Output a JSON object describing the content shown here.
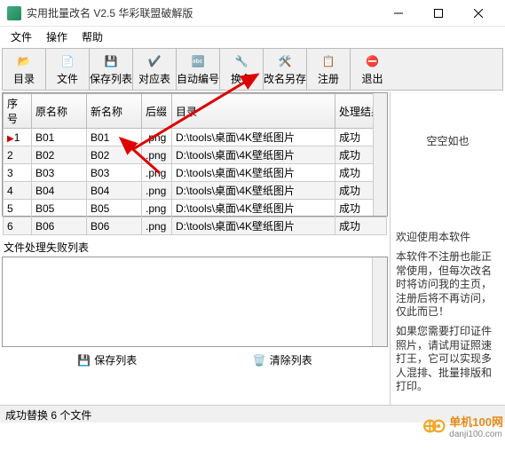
{
  "window": {
    "title": "实用批量改名 V2.5 华彩联盟破解版"
  },
  "menu": {
    "file": "文件",
    "operate": "操作",
    "help": "帮助"
  },
  "toolbar": {
    "dir": "目录",
    "files": "文件",
    "savelist": "保存列表",
    "map": "对应表",
    "autonum": "自动编号",
    "rename": "换名",
    "saveas": "改名另存",
    "register": "注册",
    "exit": "退出"
  },
  "table": {
    "headers": {
      "index": "序号",
      "oldname": "原名称",
      "newname": "新名称",
      "ext": "后缀",
      "dir": "目录",
      "result": "处理结果"
    },
    "rows": [
      {
        "idx": "1",
        "old": "B01",
        "new": "B01",
        "ext": ".png",
        "dir": "D:\\tools\\桌面\\4K壁纸图片",
        "res": "成功"
      },
      {
        "idx": "2",
        "old": "B02",
        "new": "B02",
        "ext": ".png",
        "dir": "D:\\tools\\桌面\\4K壁纸图片",
        "res": "成功"
      },
      {
        "idx": "3",
        "old": "B03",
        "new": "B03",
        "ext": ".png",
        "dir": "D:\\tools\\桌面\\4K壁纸图片",
        "res": "成功"
      },
      {
        "idx": "4",
        "old": "B04",
        "new": "B04",
        "ext": ".png",
        "dir": "D:\\tools\\桌面\\4K壁纸图片",
        "res": "成功"
      },
      {
        "idx": "5",
        "old": "B05",
        "new": "B05",
        "ext": ".png",
        "dir": "D:\\tools\\桌面\\4K壁纸图片",
        "res": "成功"
      },
      {
        "idx": "6",
        "old": "B06",
        "new": "B06",
        "ext": ".png",
        "dir": "D:\\tools\\桌面\\4K壁纸图片",
        "res": "成功"
      }
    ]
  },
  "fail_label": "文件处理失败列表",
  "buttons": {
    "save": "保存列表",
    "clear": "清除列表"
  },
  "status": "成功替换 6 个文件",
  "sidebar": {
    "empty": "空空如也",
    "welcome": "欢迎使用本软件",
    "note1": "本软件不注册也能正常使用，但每次改名时将访问我的主页，注册后将不再访问，仅此而已！",
    "note2": "如果您需要打印证件照片，请试用证照速打王，它可以实现多人混排、批量排版和打印。"
  },
  "watermark": {
    "brand": "单机100网",
    "url": "danji100.com"
  }
}
